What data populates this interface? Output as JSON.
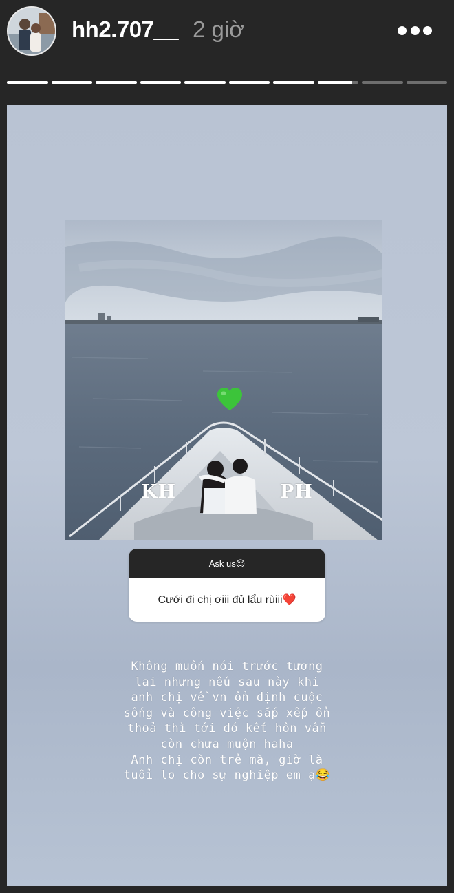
{
  "header": {
    "username": "hh2.707__",
    "timestamp": "2 giờ",
    "avatar_icon": "profile-photo",
    "more_icon": "more-horizontal-icon"
  },
  "progress": {
    "segment_count": 10,
    "current_index": 7,
    "current_fraction": 0.85
  },
  "story": {
    "photo": {
      "tag_left": "KH",
      "tag_right": "PH",
      "sticker_icon": "green-heart-icon"
    },
    "question_sticker": {
      "prompt": "Ask us😌",
      "question": "Cưới đi chị ơiii đủ lẩu rùiii❤️"
    },
    "caption_lines": [
      "Không muốn nói trước tương",
      "lai nhưng nếu sau này khi",
      "anh chị về vn ổn định cuộc",
      "sống và công việc sắp xếp ổn",
      "thoả thì tới đó kết hôn vẫn",
      "còn chưa muộn haha",
      "Anh chị còn trẻ mà, giờ là",
      "tuổi lo cho sự nghiệp em ạ😂"
    ]
  },
  "colors": {
    "chrome": "#262626",
    "progress_filled": "#ffffff",
    "progress_empty": "#6e6e6e",
    "heart": "#3cc43a"
  }
}
